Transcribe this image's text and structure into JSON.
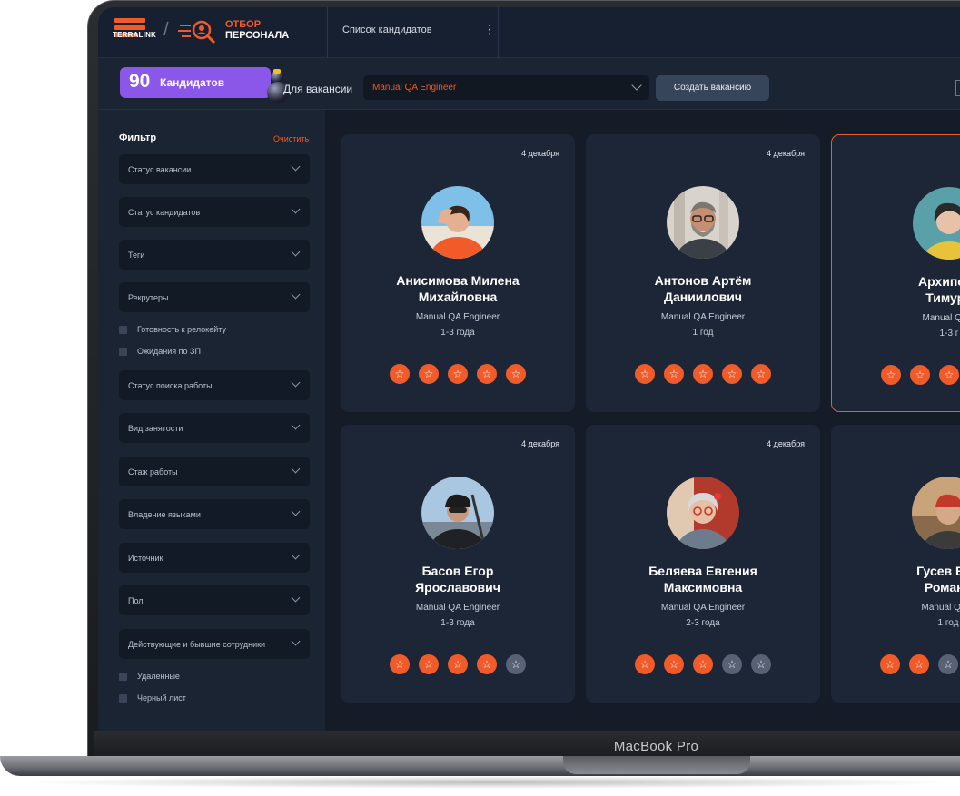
{
  "device": {
    "label": "MacBook Pro"
  },
  "topbar": {
    "brand_logo_text": "TERRALINK",
    "app_name_line1": "ОТБОР",
    "app_name_line2": "ПЕРСОНАЛА",
    "page_title": "Список кандидатов",
    "menu_icon": "kebab-icon"
  },
  "subbar": {
    "candidates_count": "90",
    "candidates_label": "Кандидатов",
    "vacancy_label": "Для вакансии",
    "vacancy_value": "Manual QA Engineer",
    "create_button": "Создать вакансию"
  },
  "filter": {
    "title": "Фильтр",
    "clear": "Очистить",
    "items": [
      {
        "type": "select",
        "label": "Статус вакансии"
      },
      {
        "type": "select",
        "label": "Статус кандидатов"
      },
      {
        "type": "select",
        "label": "Теги"
      },
      {
        "type": "select",
        "label": "Рекрутеры"
      },
      {
        "type": "checkbox",
        "label": "Готовность к релокейту"
      },
      {
        "type": "checkbox",
        "label": "Ожидания по ЗП"
      },
      {
        "type": "select",
        "label": "Статус поиска работы"
      },
      {
        "type": "select",
        "label": "Вид занятости"
      },
      {
        "type": "select",
        "label": "Стаж работы"
      },
      {
        "type": "select",
        "label": "Владение языками"
      },
      {
        "type": "select",
        "label": "Источник"
      },
      {
        "type": "select",
        "label": "Пол"
      },
      {
        "type": "select",
        "label": "Действующие и бывшие сотрудники"
      },
      {
        "type": "checkbox",
        "label": "Удаленные"
      },
      {
        "type": "checkbox",
        "label": "Черный лист"
      }
    ]
  },
  "cards": [
    {
      "date": "4 декабря",
      "name1": "Анисимова Милена",
      "name2": "Михайловна",
      "position": "Manual QA Engineer",
      "experience": "1-3 года",
      "rating": 5,
      "selected": false
    },
    {
      "date": "4 декабря",
      "name1": "Антонов Артём",
      "name2": "Даниилович",
      "position": "Manual QA Engineer",
      "experience": "1 год",
      "rating": 5,
      "selected": false
    },
    {
      "date": "",
      "name1": "Архипова",
      "name2": "Тимуро",
      "position": "Manual QA E",
      "experience": "1-3 г",
      "rating": 5,
      "selected": true
    },
    {
      "date": "4 декабря",
      "name1": "Басов Егор",
      "name2": "Ярославович",
      "position": "Manual QA Engineer",
      "experience": "1-3 года",
      "rating": 4,
      "selected": false
    },
    {
      "date": "4 декабря",
      "name1": "Беляева Евгения",
      "name2": "Максимовна",
      "position": "Manual QA Engineer",
      "experience": "2-3 года",
      "rating": 3,
      "selected": false
    },
    {
      "date": "",
      "name1": "Гусев Вла",
      "name2": "Романо",
      "position": "Manual QA E",
      "experience": "1 год",
      "rating": 2,
      "selected": false
    }
  ],
  "colors": {
    "accent": "#f15a29",
    "badge": "#8a57e8",
    "bg": "#151c27",
    "card": "#1d2636"
  }
}
